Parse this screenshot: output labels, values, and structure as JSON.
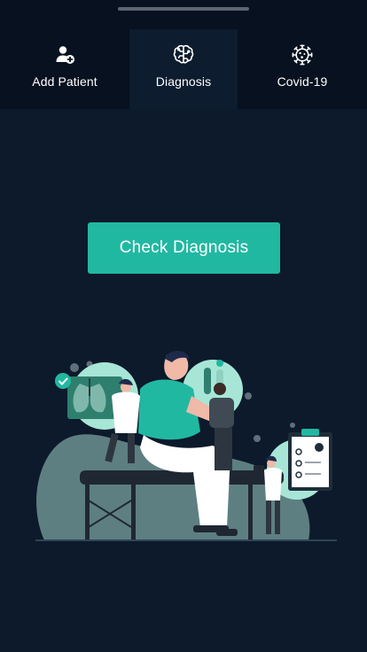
{
  "tabs": [
    {
      "label": "Add Patient",
      "icon": "add-user-icon",
      "active": false
    },
    {
      "label": "Diagnosis",
      "icon": "brain-icon",
      "active": true
    },
    {
      "label": "Covid-19",
      "icon": "virus-icon",
      "active": false
    }
  ],
  "main": {
    "cta_label": "Check Diagnosis",
    "illustration_icon": "medical-checkup-illustration"
  },
  "colors": {
    "background": "#0c1a2b",
    "tab_bar": "#07111f",
    "tab_active": "#0d1c2e",
    "accent": "#21b8a2",
    "text": "#ffffff"
  }
}
